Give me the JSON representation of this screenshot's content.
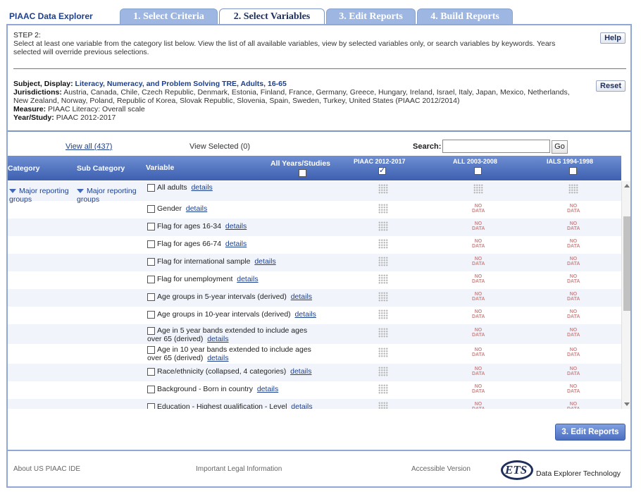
{
  "app_title": "PIAAC Data Explorer",
  "tabs": [
    {
      "label": "1. Select Criteria"
    },
    {
      "label": "2. Select Variables"
    },
    {
      "label": "3. Edit Reports"
    },
    {
      "label": "4. Build Reports"
    }
  ],
  "step": {
    "heading": "STEP 2:",
    "text": "Select at least one variable from the category list below. View the list of all available variables, view by selected variables only, or search variables by keywords. Years selected will override previous selections.",
    "help_label": "Help",
    "reset_label": "Reset"
  },
  "summary": {
    "subject_key": "Subject, Display:",
    "subject_val": "Literacy, Numeracy, and Problem Solving TRE, Adults, 16-65",
    "jur_key": "Jurisdictions:",
    "jur_val": "Austria, Canada, Chile, Czech Republic, Denmark, Estonia, Finland, France, Germany, Greece, Hungary, Ireland, Israel, Italy, Japan, Mexico, Netherlands, New Zealand, Norway, Poland, Republic of Korea, Slovak Republic, Slovenia, Spain, Sweden, Turkey, United States (PIAAC 2012/2014)",
    "measure_key": "Measure:",
    "measure_val": "PIAAC Literacy: Overall scale",
    "year_key": "Year/Study:",
    "year_val": "PIAAC 2012-2017"
  },
  "controls": {
    "view_all": "View all (437)",
    "view_selected": "View Selected (0)",
    "search_label": "Search:",
    "search_value": "",
    "go_label": "Go"
  },
  "table_header": {
    "category": "Category",
    "sub_category": "Sub Category",
    "variable": "Variable",
    "all_years": "All Years/Studies",
    "piaac": "PIAAC 2012-2017",
    "all_2003": "ALL 2003-2008",
    "ials": "IALS 1994-1998"
  },
  "category": {
    "label": "Major reporting groups"
  },
  "sub_category": {
    "label": "Major reporting groups"
  },
  "details_label": "details",
  "no_data_top": "NO",
  "no_data_bottom": "DATA",
  "variables": [
    {
      "label": "All adults"
    },
    {
      "label": "Gender"
    },
    {
      "label": "Flag for ages 16-34"
    },
    {
      "label": "Flag for ages 66-74"
    },
    {
      "label": "Flag for international sample"
    },
    {
      "label": "Flag for unemployment"
    },
    {
      "label": "Age groups in 5-year intervals (derived)"
    },
    {
      "label": "Age groups in 10-year intervals (derived)"
    },
    {
      "label": "Age in 5 year bands extended to include ages",
      "label2": "over 65 (derived)"
    },
    {
      "label": "Age in 10 year bands extended to include ages",
      "label2": "over 65 (derived)"
    },
    {
      "label": "Race/ethnicity (collapsed, 4 categories)"
    },
    {
      "label": "Background - Born in country"
    },
    {
      "label": "Education - Highest qualification - Level"
    }
  ],
  "edit_reports_label": "3. Edit Reports",
  "footer": {
    "about": "About US PIAAC IDE",
    "legal": "Important Legal Information",
    "accessible": "Accessible Version",
    "ets_logo": "ETS",
    "tech": "Data Explorer Technology"
  }
}
